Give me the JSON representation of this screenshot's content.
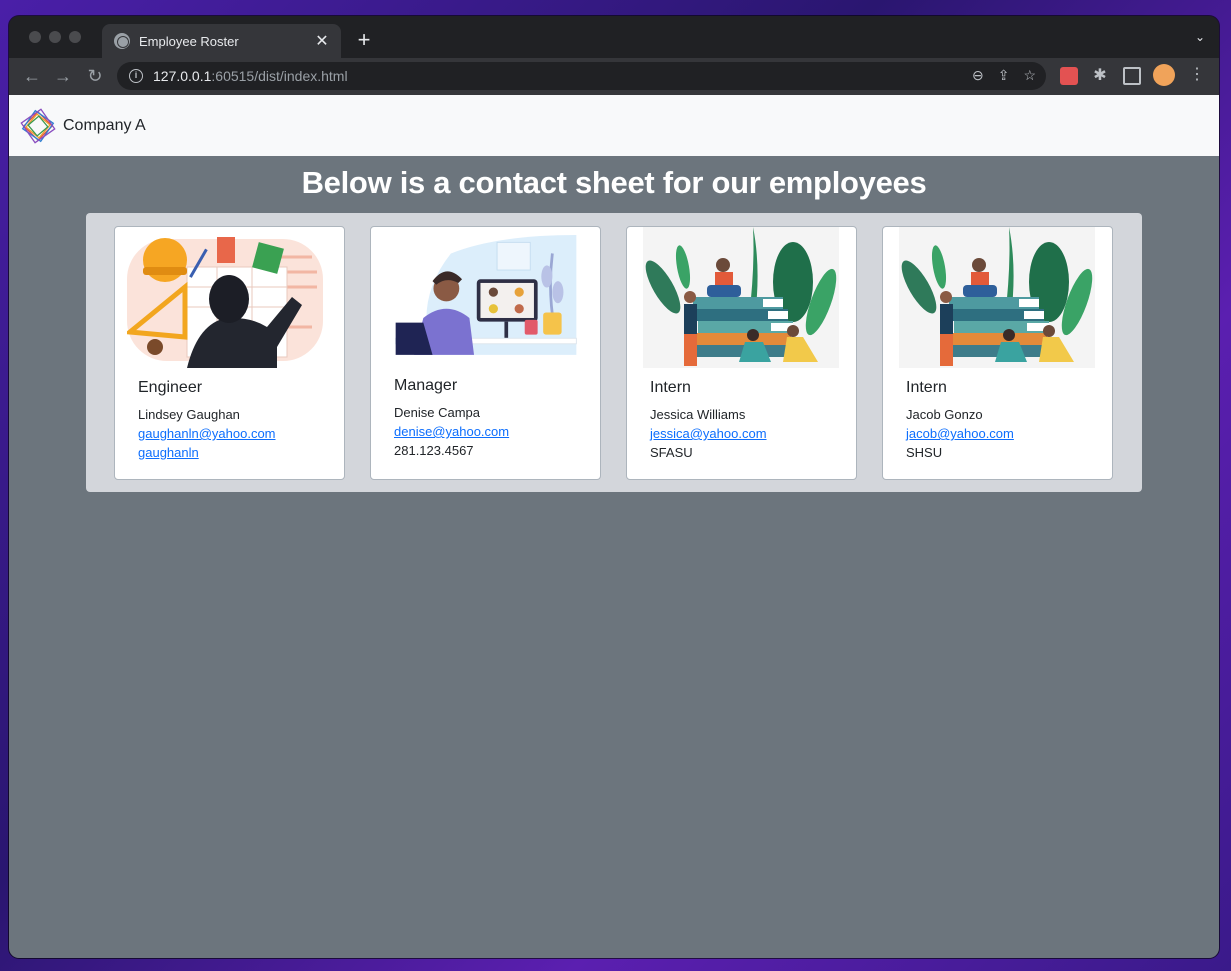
{
  "browser": {
    "tab_title": "Employee Roster",
    "url_host": "127.0.0.1",
    "url_rest": ":60515/dist/index.html"
  },
  "navbar": {
    "brand": "Company A"
  },
  "page": {
    "heading": "Below is a contact sheet for our employees"
  },
  "cards": [
    {
      "role": "Engineer",
      "name": "Lindsey Gaughan",
      "email": "gaughanln@yahoo.com",
      "extra": "gaughanln",
      "extra_is_link": true,
      "illustration": "engineer-illustration"
    },
    {
      "role": "Manager",
      "name": "Denise Campa",
      "email": "denise@yahoo.com",
      "extra": "281.123.4567",
      "extra_is_link": false,
      "illustration": "manager-illustration"
    },
    {
      "role": "Intern",
      "name": "Jessica Williams",
      "email": "jessica@yahoo.com",
      "extra": "SFASU",
      "extra_is_link": false,
      "illustration": "intern-illustration"
    },
    {
      "role": "Intern",
      "name": "Jacob Gonzo",
      "email": "jacob@yahoo.com",
      "extra": "SHSU",
      "extra_is_link": false,
      "illustration": "intern-illustration"
    }
  ],
  "colors": {
    "page_bg": "#6c757d",
    "panel_bg": "#d3d6db",
    "link": "#0d6efd",
    "navbar_bg": "#f8f9fa"
  }
}
